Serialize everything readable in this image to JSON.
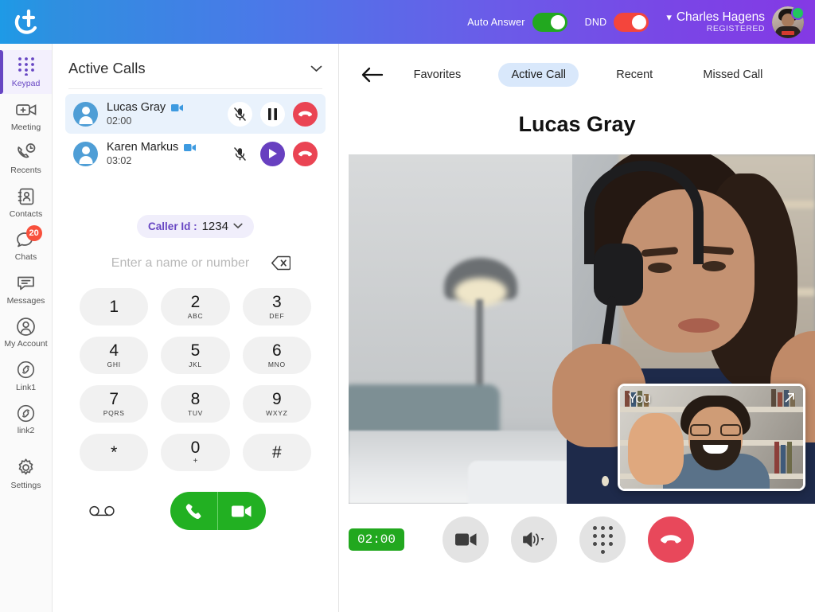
{
  "header": {
    "logo_icon": "app-logo-t",
    "auto_answer": {
      "label": "Auto Answer",
      "state": "on",
      "color": "#22a81f"
    },
    "dnd": {
      "label": "DND",
      "state": "on",
      "color": "#f4453c"
    },
    "user": {
      "name": "Charles Hagens",
      "status": "REGISTERED",
      "presence": "online",
      "chevron": "chevron-down"
    }
  },
  "sidebar": {
    "items": [
      {
        "label": "Keypad",
        "icon": "keypad-icon",
        "active": true
      },
      {
        "label": "Meeting",
        "icon": "meeting-video-icon",
        "active": false
      },
      {
        "label": "Recents",
        "icon": "recents-clock-phone-icon",
        "active": false
      },
      {
        "label": "Contacts",
        "icon": "contacts-book-icon",
        "active": false
      },
      {
        "label": "Chats",
        "icon": "chats-bubble-icon",
        "active": false,
        "badge": "20"
      },
      {
        "label": "Messages",
        "icon": "messages-bubble-icon",
        "active": false
      },
      {
        "label": "My Account",
        "icon": "user-circle-icon",
        "active": false
      },
      {
        "label": "Link1",
        "icon": "link-circle-icon",
        "active": false
      },
      {
        "label": "link2",
        "icon": "link-circle-icon",
        "active": false
      },
      {
        "label": "Settings",
        "icon": "gear-icon",
        "active": false
      }
    ]
  },
  "panel": {
    "title": "Active Calls",
    "collapse_icon": "chevron-down-icon",
    "calls": [
      {
        "name": "Lucas Gray",
        "duration": "02:00",
        "video": true,
        "selected": true,
        "actions": [
          "mic-muted-icon",
          "pause-icon",
          "end-call-icon"
        ]
      },
      {
        "name": "Karen Markus",
        "duration": "03:02",
        "video": true,
        "selected": false,
        "actions": [
          "mic-muted-icon",
          "resume-play-icon",
          "end-call-icon"
        ]
      }
    ],
    "caller_id": {
      "label": "Caller Id :",
      "value": "1234",
      "chevron": "chevron-down-icon"
    },
    "dial_input": {
      "value": "",
      "placeholder": "Enter a name or number",
      "clear_icon": "backspace-icon"
    },
    "keys": [
      {
        "digit": "1",
        "sub": ""
      },
      {
        "digit": "2",
        "sub": "ABC"
      },
      {
        "digit": "3",
        "sub": "DEF"
      },
      {
        "digit": "4",
        "sub": "GHI"
      },
      {
        "digit": "5",
        "sub": "JKL"
      },
      {
        "digit": "6",
        "sub": "MNO"
      },
      {
        "digit": "7",
        "sub": "PQRS"
      },
      {
        "digit": "8",
        "sub": "TUV"
      },
      {
        "digit": "9",
        "sub": "WXYZ"
      },
      {
        "digit": "*",
        "sub": ""
      },
      {
        "digit": "0",
        "sub": "+"
      },
      {
        "digit": "#",
        "sub": ""
      }
    ],
    "voicemail_icon": "voicemail-icon",
    "call_button_icon": "phone-icon",
    "video_call_button_icon": "video-camera-icon"
  },
  "main": {
    "back_icon": "arrow-left-icon",
    "tabs": [
      {
        "label": "Favorites",
        "active": false
      },
      {
        "label": "Active Call",
        "active": true
      },
      {
        "label": "Recent",
        "active": false
      },
      {
        "label": "Missed Call",
        "active": false
      }
    ],
    "call_name": "Lucas Gray",
    "pip": {
      "label": "You",
      "expand_icon": "expand-arrow-icon"
    },
    "timer": "02:00",
    "controls": [
      {
        "icon": "video-camera-icon",
        "name": "video-toggle-button"
      },
      {
        "icon": "speaker-icon",
        "name": "speaker-button"
      },
      {
        "icon": "keypad-dots-icon",
        "name": "dialpad-button"
      },
      {
        "icon": "end-call-icon",
        "name": "end-call-button"
      }
    ]
  },
  "colors": {
    "accent_purple": "#6746c3",
    "brand_blue": "#1e9ae6",
    "green": "#22a81f",
    "red": "#e8485b",
    "tab_active_bg": "#d9e8fb"
  }
}
